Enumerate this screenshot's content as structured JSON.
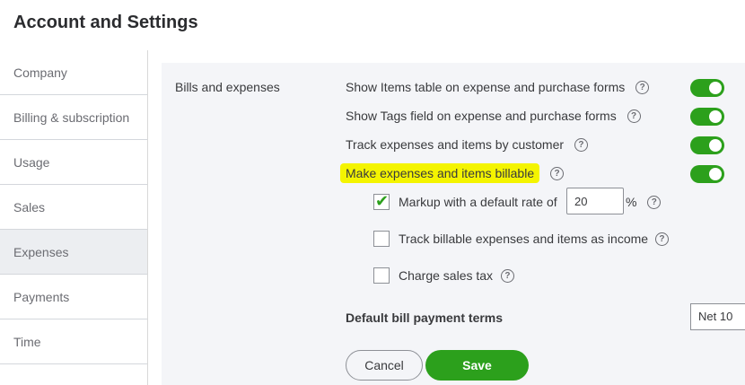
{
  "page_title": "Account and Settings",
  "sidebar": {
    "items": [
      {
        "label": "Company"
      },
      {
        "label": "Billing & subscription"
      },
      {
        "label": "Usage"
      },
      {
        "label": "Sales"
      },
      {
        "label": "Expenses"
      },
      {
        "label": "Payments"
      },
      {
        "label": "Time"
      }
    ]
  },
  "section": {
    "label": "Bills and expenses",
    "settings": [
      {
        "label": "Show Items table on expense and purchase forms",
        "enabled": true
      },
      {
        "label": "Show Tags field on expense and purchase forms",
        "enabled": true
      },
      {
        "label": "Track expenses and items by customer",
        "enabled": true
      },
      {
        "label": "Make expenses and items billable",
        "enabled": true
      }
    ],
    "sub_options": {
      "markup": {
        "label": "Markup with a default rate of",
        "checked": true,
        "value": "20",
        "unit": "%"
      },
      "track_income": {
        "label": "Track billable expenses and items as income",
        "checked": false
      },
      "sales_tax": {
        "label": "Charge sales tax",
        "checked": false
      }
    },
    "payment_terms": {
      "label": "Default bill payment terms",
      "value": "Net 10"
    }
  },
  "help_glyph": "?",
  "buttons": {
    "cancel": "Cancel",
    "save": "Save"
  },
  "colors": {
    "accent": "#2ca01c",
    "highlight": "#f4f400",
    "active_bg": "#eceef1"
  }
}
